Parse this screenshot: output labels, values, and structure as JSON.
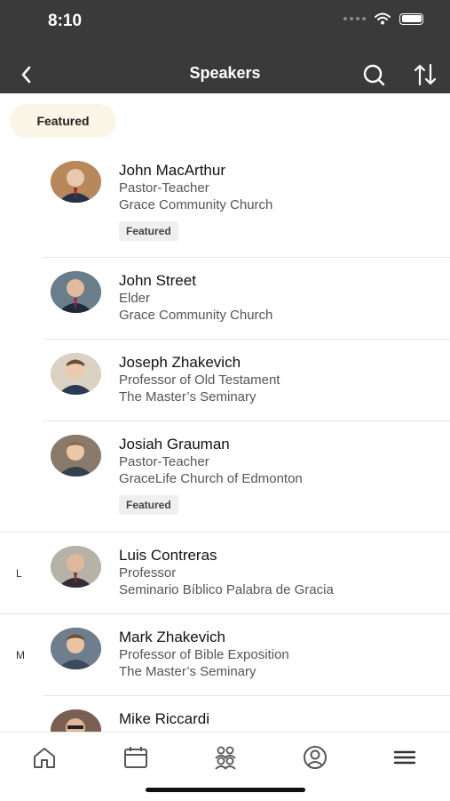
{
  "status": {
    "time": "8:10"
  },
  "nav": {
    "title": "Speakers"
  },
  "filter": {
    "label": "Featured"
  },
  "speakers": [
    {
      "name": "John MacArthur",
      "role": "Pastor-Teacher",
      "org": "Grace Community Church",
      "badge": "Featured",
      "avatar_color": "#b8885a"
    },
    {
      "name": "John Street",
      "role": "Elder",
      "org": "Grace Community Church",
      "avatar_color": "#6a7d8a"
    },
    {
      "name": "Joseph Zhakevich",
      "role": "Professor of Old Testament",
      "org": "The Master’s Seminary",
      "avatar_color": "#c9b08f"
    },
    {
      "name": "Josiah Grauman",
      "role": "Pastor-Teacher",
      "org": "GraceLife Church of Edmonton",
      "badge": "Featured",
      "avatar_color": "#8a7a6a"
    },
    {
      "name": "Luis Contreras",
      "role": "Professor",
      "org": "Seminario Bíblico Palabra de Gracia",
      "section": "L",
      "avatar_color": "#a8a29a"
    },
    {
      "name": "Mark Zhakevich",
      "role": "Professor of Bible Exposition",
      "org": "The Master’s Seminary",
      "section": "M",
      "avatar_color": "#6f7e8c"
    },
    {
      "name": "Mike Riccardi",
      "avatar_color": "#7a6050"
    }
  ],
  "tabs": [
    "home-icon",
    "calendar-icon",
    "people-icon",
    "profile-icon",
    "menu-icon"
  ]
}
